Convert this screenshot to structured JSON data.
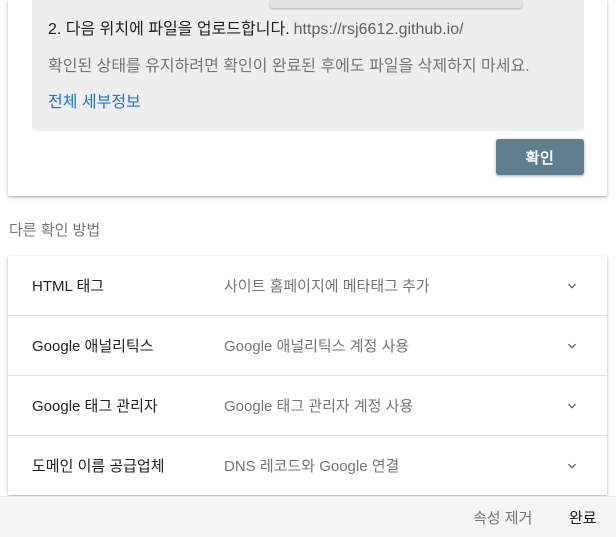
{
  "verify_card": {
    "step_text": "2. 다음 위치에 파일을 업로드합니다.",
    "step_url": "https://rsj6612.github.io/",
    "note": "확인된 상태를 유지하려면 확인이 완료된 후에도 파일을 삭제하지 마세요.",
    "details_link": "전체 세부정보",
    "verify_button": "확인",
    "button_color": "#5f7e8d",
    "link_color": "#1a73e8"
  },
  "other_methods": {
    "title": "다른 확인 방법",
    "items": [
      {
        "name": "HTML 태그",
        "description": "사이트 홈페이지에 메타태그 추가",
        "icon": "chevron-down-icon"
      },
      {
        "name": "Google 애널리틱스",
        "description": "Google 애널리틱스 계정 사용",
        "icon": "chevron-down-icon"
      },
      {
        "name": "Google 태그 관리자",
        "description": "Google 태그 관리자 계정 사용",
        "icon": "chevron-down-icon"
      },
      {
        "name": "도메인 이름 공급업체",
        "description": "DNS 레코드와 Google 연결",
        "icon": "chevron-down-icon"
      }
    ]
  },
  "footer": {
    "remove_label": "속성 제거",
    "done_label": "완료"
  }
}
